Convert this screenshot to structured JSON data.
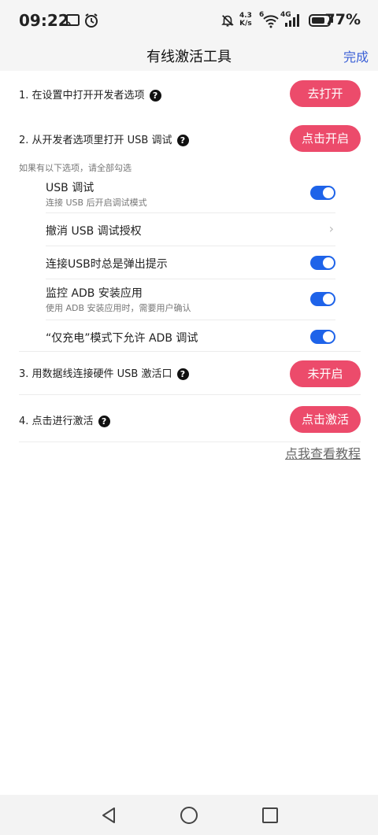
{
  "status": {
    "time": "09:22",
    "speed_value": "4.3",
    "speed_unit": "K/s",
    "wifi_gen": "6",
    "net_type": "4G",
    "battery": "77%"
  },
  "nav": {
    "title": "有线激活工具",
    "done": "完成"
  },
  "steps": [
    {
      "label": "1. 在设置中打开开发者选项",
      "button": "去打开"
    },
    {
      "label": "2. 从开发者选项里打开 USB 调试",
      "button": "点击开启"
    },
    {
      "label": "3. 用数据线连接硬件 USB 激活口",
      "button": "未开启"
    },
    {
      "label": "4. 点击进行激活",
      "button": "点击激活"
    }
  ],
  "hint": "如果有以下选项，请全部勾选",
  "options": [
    {
      "title": "USB 调试",
      "subtitle": "连接 USB 后开启调试模式",
      "enabled": true
    },
    {
      "title": "撤消 USB 调试授权"
    },
    {
      "title": "连接USB时总是弹出提示",
      "enabled": true
    },
    {
      "title": "监控 ADB 安装应用",
      "subtitle": "使用 ADB 安装应用时，需要用户确认",
      "enabled": true
    },
    {
      "title": "“仅充电”模式下允许 ADB 调试",
      "enabled": true
    }
  ],
  "tutorial_link": "点我查看教程",
  "colors": {
    "accent_button": "#ec4b6b",
    "toggle_on": "#1e63e9",
    "link_blue": "#3a5fd6"
  }
}
